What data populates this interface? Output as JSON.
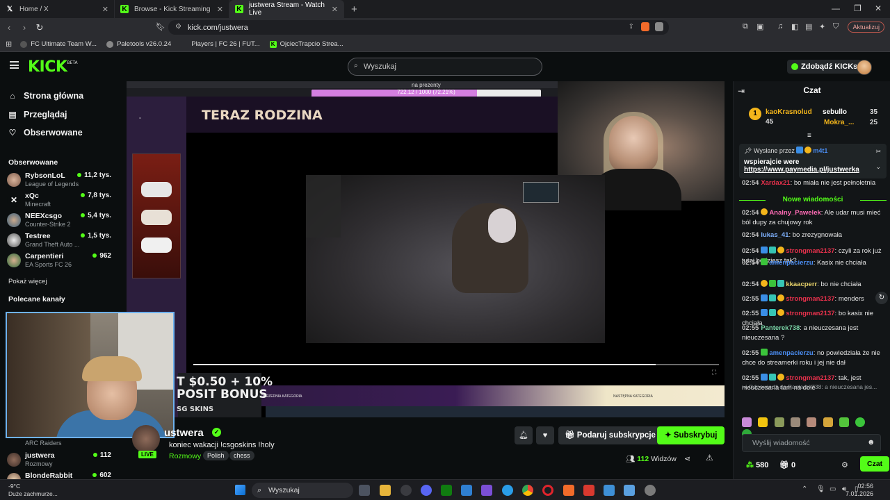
{
  "browser": {
    "tabs": [
      {
        "label": "Home / X",
        "icon": "x-logo-icon"
      },
      {
        "label": "Browse - Kick Streaming",
        "icon": "kick-logo-icon"
      },
      {
        "label": "justwera Stream - Watch Live",
        "icon": "kick-logo-icon"
      }
    ],
    "url": "kick.com/justwera",
    "update_label": "Aktualizuj",
    "bookmarks": [
      "FC Ultimate Team W...",
      "Paletools v26.0.24",
      "Players | FC 26 | FUT...",
      "OjciecTrapcio Strea..."
    ]
  },
  "header": {
    "logo": "KICK",
    "logo_beta": "BETA",
    "search_placeholder": "Wyszukaj",
    "kicks_label": "Zdobądź KICKs"
  },
  "sidebar": {
    "nav": [
      "Strona główna",
      "Przeglądaj",
      "Obserwowane"
    ],
    "followed_title": "Obserwowane",
    "followed": [
      {
        "name": "RybsonLoL",
        "game": "League of Legends",
        "viewers": "11,2 tys."
      },
      {
        "name": "xQc",
        "game": "Minecraft",
        "viewers": "7,8 tys."
      },
      {
        "name": "NEEXcsgo",
        "game": "Counter-Strike 2",
        "viewers": "5,4 tys."
      },
      {
        "name": "Testree",
        "game": "Grand Theft Auto ...",
        "viewers": "1,5 tys."
      },
      {
        "name": "Carpentieri",
        "game": "EA Sports FC 26",
        "viewers": "962"
      }
    ],
    "show_more": "Pokaż więcej",
    "recommended_title": "Polecane kanały",
    "recommended": [
      {
        "name": "",
        "game": "ARC Raiders",
        "viewers": ""
      },
      {
        "name": "justwera",
        "game": "Rozmowy",
        "viewers": "112"
      },
      {
        "name": "BlondeRabbit",
        "game": "",
        "viewers": "602"
      }
    ]
  },
  "player": {
    "screen_title": "TERAZ RODZINA",
    "progress_label": "na prezenty",
    "progress_text": "722.12 / 1000 (72.21%)",
    "progress_fraction": 0.7221,
    "promo_line1": "T $0.50 + 10%",
    "promo_line2": "POSIT BONUS",
    "promo_brand": "SG SKINS",
    "cat_prev": "POPRZEDNIA KATEGORIA",
    "cat_next": "NASTĘPNA KATEGORIA",
    "video_progress_fraction": 0.88
  },
  "stream": {
    "name": "ustwera",
    "live": "LIVE",
    "title": "koniec wakacji !csgoskins !holy",
    "category": "Rozmowy",
    "tags": [
      "Polish",
      "chess"
    ],
    "gift_label": "Podaruj subskrypcje",
    "sub_label": "Subskrybuj",
    "viewers_count": "112",
    "viewers_label": "Widzów"
  },
  "chat": {
    "title": "Czat",
    "leaders": [
      {
        "name": "kaoKrasnolud",
        "value": "45",
        "color": "#f3b51b"
      },
      {
        "name": "sebullo",
        "value": "35",
        "color": "#ffffff"
      },
      {
        "name": "Mokra_...",
        "value": "25",
        "color": "#f3b51b"
      }
    ],
    "pinned_by": "Wysłane przez",
    "pinned_user": "m4t1",
    "pinned_message": "wspierajcie were",
    "pinned_link": "https://www.paymedia.pl/justwerka",
    "partial_message": {
      "time": "02:54",
      "user": "Xardax21",
      "text": "bo miała nie jest pełnoletnia"
    },
    "new_messages": "Nowe wiadomości",
    "messages": [
      {
        "time": "02:54",
        "user": "Analny_Pawelek",
        "color": "#ff6bb5",
        "badges": [
          "gold"
        ],
        "text": "Ale udar musi mieć ból dupy za chujowy rok"
      },
      {
        "time": "02:54",
        "user": "lukas_41",
        "color": "#7fb2ff",
        "badges": [],
        "text": "bo zrezygnowała"
      },
      {
        "time": "02:54",
        "user": "strongman2137",
        "color": "#e8314c",
        "badges": [
          "blue",
          "teal",
          "gold"
        ],
        "text": "czyli za rok już tutaj będziesz tak?"
      },
      {
        "time": "02:54",
        "user": "amenpacierzu",
        "color": "#4a8cf0",
        "badges": [
          "green"
        ],
        "text": "Kasix nie chciała"
      },
      {
        "time": "02:54",
        "user": "kkaacperr",
        "color": "#e8d36b",
        "badges": [
          "gold",
          "green",
          "teal"
        ],
        "text": "bo nie chciała"
      },
      {
        "time": "02:55",
        "user": "strongman2137",
        "color": "#e8314c",
        "badges": [
          "blue",
          "teal",
          "gold"
        ],
        "text": "menders"
      },
      {
        "time": "02:55",
        "user": "strongman2137",
        "color": "#e8314c",
        "badges": [
          "blue",
          "teal",
          "gold"
        ],
        "text": "bo kasix nie chciała"
      },
      {
        "time": "02:55",
        "user": "Panterek738",
        "color": "#7bd5a8",
        "badges": [],
        "text": "a nieuczesana jest nieuczesana ?"
      },
      {
        "time": "02:55",
        "user": "amenpacierzu",
        "color": "#4a8cf0",
        "badges": [
          "green"
        ],
        "text": "no powiedziała że nie chce do streamerki roku i jej nie dał"
      },
      {
        "time": "02:55",
        "user": "strongman2137",
        "color": "#e8314c",
        "badges": [
          "blue",
          "teal",
          "gold"
        ],
        "text": "tak, jest nieuczesana tam na dole"
      }
    ],
    "reply_hint": "Odpowiedź do Panterek738: a nieuczesana jes...",
    "input_placeholder": "Wyślij wiadomość",
    "points": "580",
    "gifts": "0",
    "send_label": "Czat"
  },
  "taskbar": {
    "temperature": "-9°C",
    "weather": "Duże zachmurze...",
    "search_label": "Wyszukaj",
    "time": "02:56",
    "date": "7.01.2026"
  }
}
